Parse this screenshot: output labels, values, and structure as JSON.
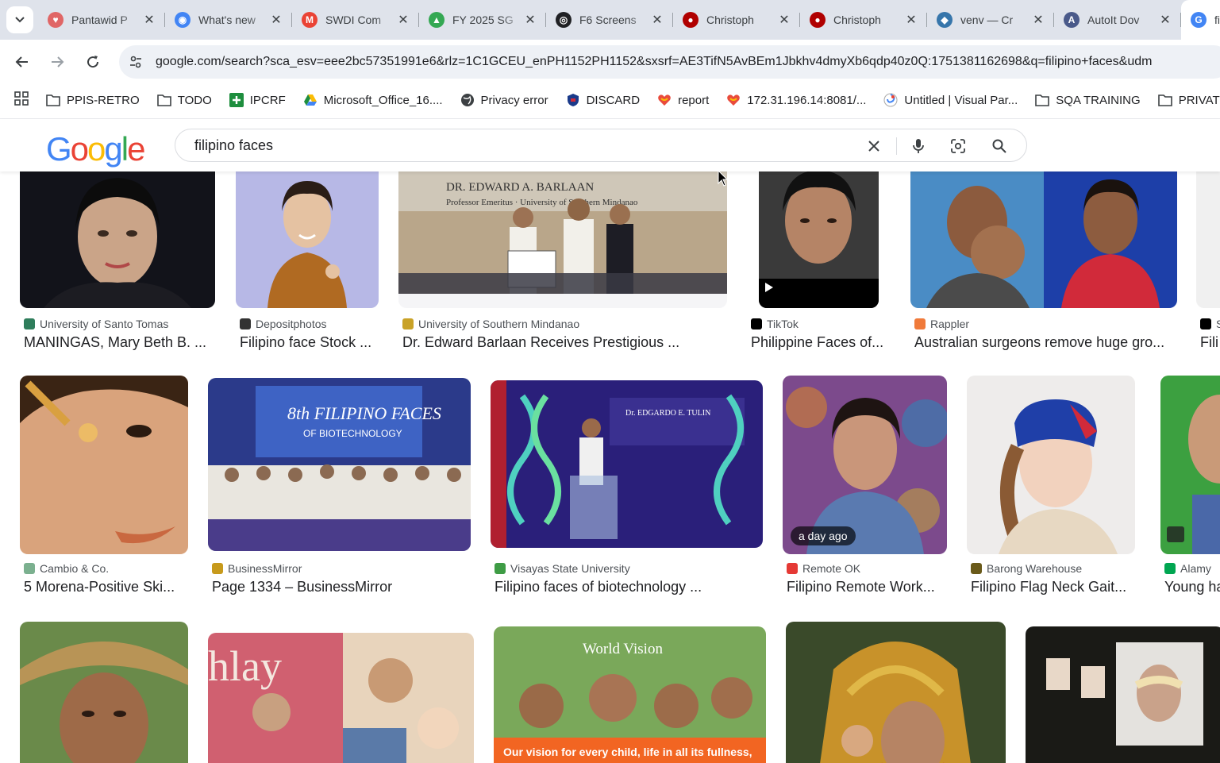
{
  "tabs": [
    {
      "label": "Pantawid P",
      "color": "#e06666",
      "glyph": "♥"
    },
    {
      "label": "What's new",
      "color": "#4285f4",
      "glyph": "◉"
    },
    {
      "label": "SWDI Com",
      "color": "#ea4335",
      "glyph": "M"
    },
    {
      "label": "FY 2025 SG",
      "color": "#34a853",
      "glyph": "▲"
    },
    {
      "label": "F6 Screens",
      "color": "#202124",
      "glyph": "◎"
    },
    {
      "label": "Christoph",
      "color": "#b00000",
      "glyph": "●"
    },
    {
      "label": "Christoph",
      "color": "#b00000",
      "glyph": "●"
    },
    {
      "label": "venv — Cr",
      "color": "#3776ab",
      "glyph": "◆"
    },
    {
      "label": "AutoIt Dov",
      "color": "#4a5a8a",
      "glyph": "A"
    },
    {
      "label": "fi",
      "color": "#4285f4",
      "glyph": "G"
    }
  ],
  "url": "google.com/search?sca_esv=eee2bc57351991e6&rlz=1C1GCEU_enPH1152PH1152&sxsrf=AE3TifN5AvBEm1Jbkhv4dmyXb6qdp40z0Q:1751381162698&q=filipino+faces&udm",
  "bookmarks": [
    {
      "label": "PPIS-RETRO",
      "icon": "folder"
    },
    {
      "label": "TODO",
      "icon": "folder"
    },
    {
      "label": "IPCRF",
      "icon": "plus-green"
    },
    {
      "label": "Microsoft_Office_16....",
      "icon": "drive"
    },
    {
      "label": "Privacy error",
      "icon": "globe"
    },
    {
      "label": "DISCARD",
      "icon": "shield"
    },
    {
      "label": "report",
      "icon": "heart"
    },
    {
      "label": "172.31.196.14:8081/...",
      "icon": "heart"
    },
    {
      "label": "Untitled | Visual Par...",
      "icon": "swirl"
    },
    {
      "label": "SQA TRAINING",
      "icon": "folder"
    },
    {
      "label": "PRIVATE",
      "icon": "folder"
    }
  ],
  "search": {
    "query": "filipino faces"
  },
  "results": {
    "row1": [
      {
        "source": "University of Santo Tomas",
        "title": "MANINGAS, Mary Beth B. ...",
        "icon_color": "#2e7d5b"
      },
      {
        "source": "Depositphotos",
        "title": "Filipino face Stock ...",
        "icon_color": "#333333"
      },
      {
        "source": "University of Southern Mindanao",
        "title": "Dr. Edward Barlaan Receives Prestigious ...",
        "icon_color": "#c9a227"
      },
      {
        "source": "TikTok",
        "title": "Philippine Faces of...",
        "icon_color": "#000000"
      },
      {
        "source": "Rappler",
        "title": "Australian surgeons remove huge gro...",
        "icon_color": "#f07a3a"
      },
      {
        "source": "S",
        "title": "Fili",
        "icon_color": "#000000"
      }
    ],
    "row2": [
      {
        "source": "Cambio & Co.",
        "title": "5 Morena-Positive Ski...",
        "icon_color": "#7bb08f"
      },
      {
        "source": "BusinessMirror",
        "title": "Page 1334 – BusinessMirror",
        "icon_color": "#c79a1c"
      },
      {
        "source": "Visayas State University",
        "title": "Filipino faces of biotechnology ...",
        "icon_color": "#3e9c45"
      },
      {
        "source": "Remote OK",
        "title": "Filipino Remote Work...",
        "icon_color": "#e53935",
        "badge": "a day ago"
      },
      {
        "source": "Barong Warehouse",
        "title": "Filipino Flag Neck Gait...",
        "icon_color": "#6a5a1a"
      },
      {
        "source": "Alamy",
        "title": "Young ha",
        "icon_color": "#00a651"
      }
    ],
    "row3_banner": "World Vision",
    "row3_tagline": "Our vision for every child, life in all its fullness,"
  },
  "colors": {
    "tabstrip": "#dfe3eb",
    "omnibox": "#eef1f6",
    "accent": "#1a73e8"
  }
}
